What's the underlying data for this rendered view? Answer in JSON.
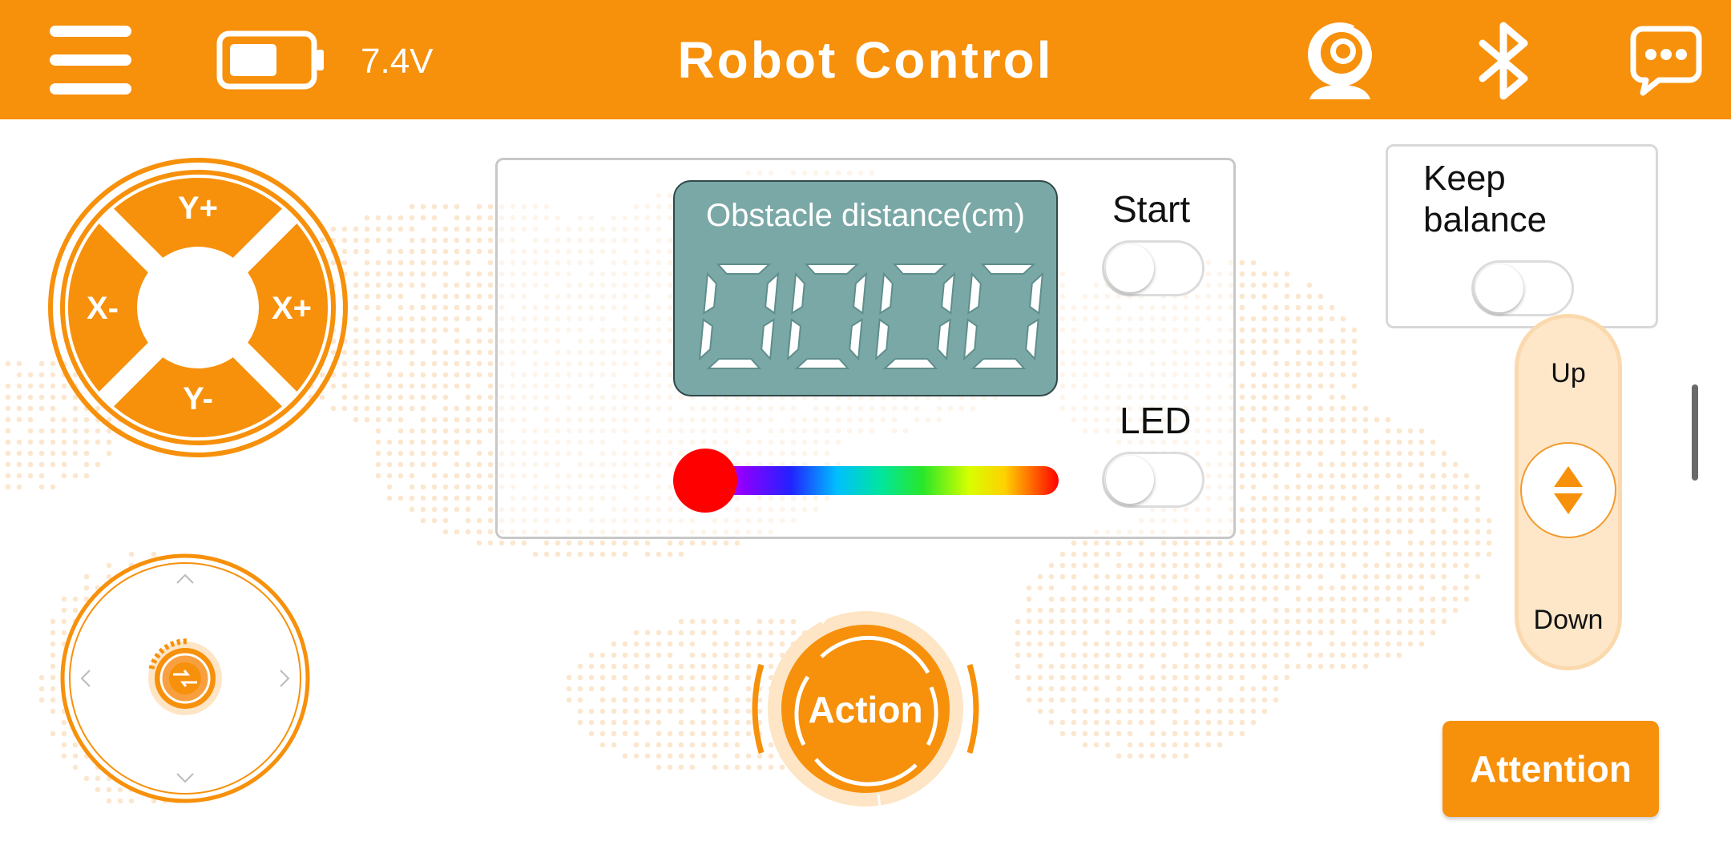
{
  "header": {
    "title": "Robot Control",
    "voltage": "7.4V",
    "icons": [
      "menu-icon",
      "battery-icon",
      "camera-icon",
      "bluetooth-icon",
      "chat-icon"
    ]
  },
  "dpad": {
    "up": "Y+",
    "down": "Y-",
    "left": "X-",
    "right": "X+"
  },
  "panel": {
    "lcd_label": "Obstacle distance(cm)",
    "lcd_value": "0000",
    "start_label": "Start",
    "led_label": "LED",
    "start_on": false,
    "led_on": false,
    "color_slider_value": 0
  },
  "keep_balance": {
    "label_line1": "Keep",
    "label_line2": "balance",
    "on": false
  },
  "height_control": {
    "up_label": "Up",
    "down_label": "Down"
  },
  "action_button": {
    "label": "Action"
  },
  "attention_button": {
    "label": "Attention"
  },
  "colors": {
    "accent": "#f7900a",
    "lcd": "#7aa8a6",
    "thumb": "#ff0000"
  }
}
